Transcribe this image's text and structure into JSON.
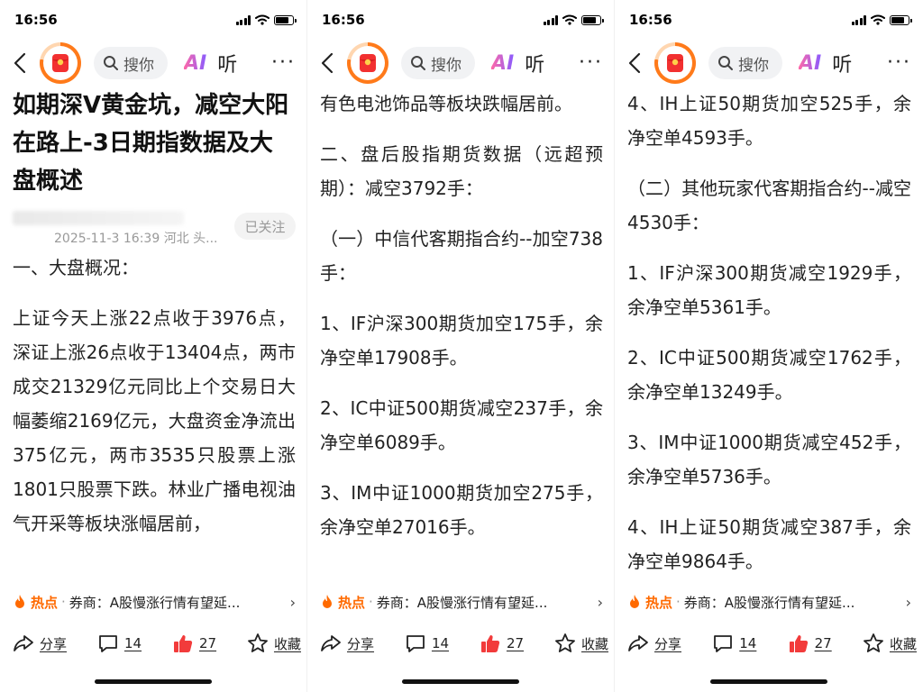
{
  "status": {
    "time": "16:56"
  },
  "nav": {
    "search_label": "搜你",
    "ai_label": "AI",
    "listen_label": "听",
    "more_label": "···"
  },
  "article": {
    "title": "如期深V黄金坑，减空大阳在路上-3日期指数据及大盘概述",
    "meta": "2025-11-3 16:39 河北 头...",
    "follow_label": "已关注"
  },
  "hot": {
    "label": "热点",
    "sep": "·",
    "text": "券商：A股慢涨行情有望延..."
  },
  "actions": {
    "share": "分享",
    "comments": "14",
    "likes": "27",
    "collect": "收藏"
  },
  "screens": [
    {
      "paras": [
        "一、大盘概况：",
        "上证今天上涨22点收于3976点，深证上涨26点收于13404点，两市成交21329亿元同比上个交易日大幅萎缩2169亿元，大盘资金净流出375亿元，两市3535只股票上涨1801只股票下跌。林业广播电视油气开采等板块涨幅居前，"
      ]
    },
    {
      "paras": [
        "有色电池饰品等板块跌幅居前。",
        "二、盘后股指期货数据（远超预期）：减空3792手：",
        "（一）中信代客期指合约--加空738手：",
        "1、IF沪深300期货加空175手，余净空单17908手。",
        "2、IC中证500期货减空237手，余净空单6089手。",
        "3、IM中证1000期货加空275手，余净空单27016手。"
      ]
    },
    {
      "paras": [
        "4、IH上证50期货加空525手，余净空单4593手。",
        "（二）其他玩家代客期指合约--减空4530手：",
        "1、IF沪深300期货减空1929手，余净空单5361手。",
        "2、IC中证500期货减空1762手，余净空单13249手。",
        "3、IM中证1000期货减空452手，余净空单5736手。",
        "4、IH上证50期货减空387手，余净空单9864手。"
      ]
    }
  ]
}
